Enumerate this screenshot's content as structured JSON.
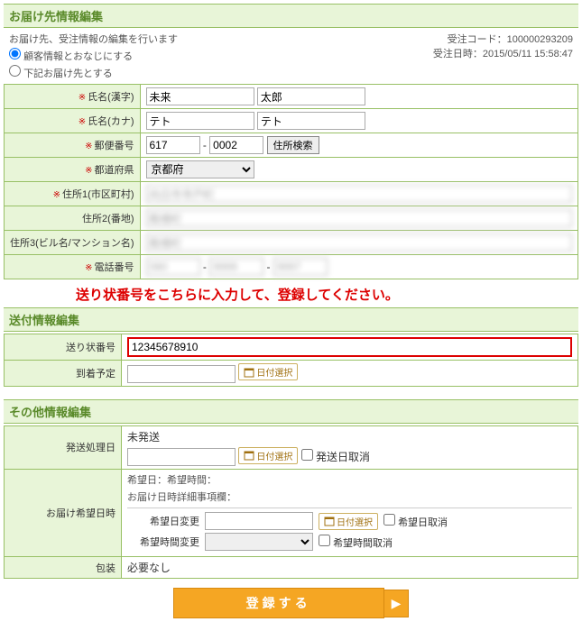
{
  "delivery": {
    "title": "お届け先情報編集",
    "intro": "お届け先、受注情報の編集を行います",
    "order_code_label": "受注コード：",
    "order_code": "100000293209",
    "order_time_label": "受注日時：",
    "order_time": "2015/05/11 15:58:47",
    "opt_same": "顧客情報とおなじにする",
    "opt_below": "下記お届け先とする",
    "labels": {
      "name_kanji": "氏名(漢字)",
      "name_kana": "氏名(カナ)",
      "zip": "郵便番号",
      "pref": "都道府県",
      "addr1": "住所1(市区町村)",
      "addr2": "住所2(番地)",
      "addr3": "住所3(ビル名/マンション名)",
      "tel": "電話番号"
    },
    "name_last": "未来",
    "name_first": "太郎",
    "kana_last": "テト",
    "kana_first": "テト",
    "zip1": "617",
    "zip2": "0002",
    "zip_btn": "住所検索",
    "pref": "京都府",
    "addr1": "向日市寺戸町",
    "addr2": "殿様町",
    "addr3": "殿様町",
    "tel1": "080",
    "tel2": "9999",
    "tel3": "9997",
    "req": "※"
  },
  "shipping": {
    "title": "送付情報編集",
    "callout": "送り状番号をこちらに入力して、登録してください。",
    "labels": {
      "invoice": "送り状番号",
      "arrival": "到着予定"
    },
    "invoice": "12345678910",
    "date_btn": "日付選択"
  },
  "other": {
    "title": "その他情報編集",
    "labels": {
      "ship_date": "発送処理日",
      "deliv_date": "お届け希望日時",
      "wrap": "包装"
    },
    "ship_status": "未発送",
    "ship_cancel": "発送日取消",
    "note1": "希望日：希望時間：",
    "note2": "お届け日時詳細事項欄：",
    "sub_date_lbl": "希望日変更",
    "sub_time_lbl": "希望時間変更",
    "date_cancel": "希望日取消",
    "time_cancel": "希望時間取消",
    "wrap_value": "必要なし"
  },
  "submit": "登録する"
}
